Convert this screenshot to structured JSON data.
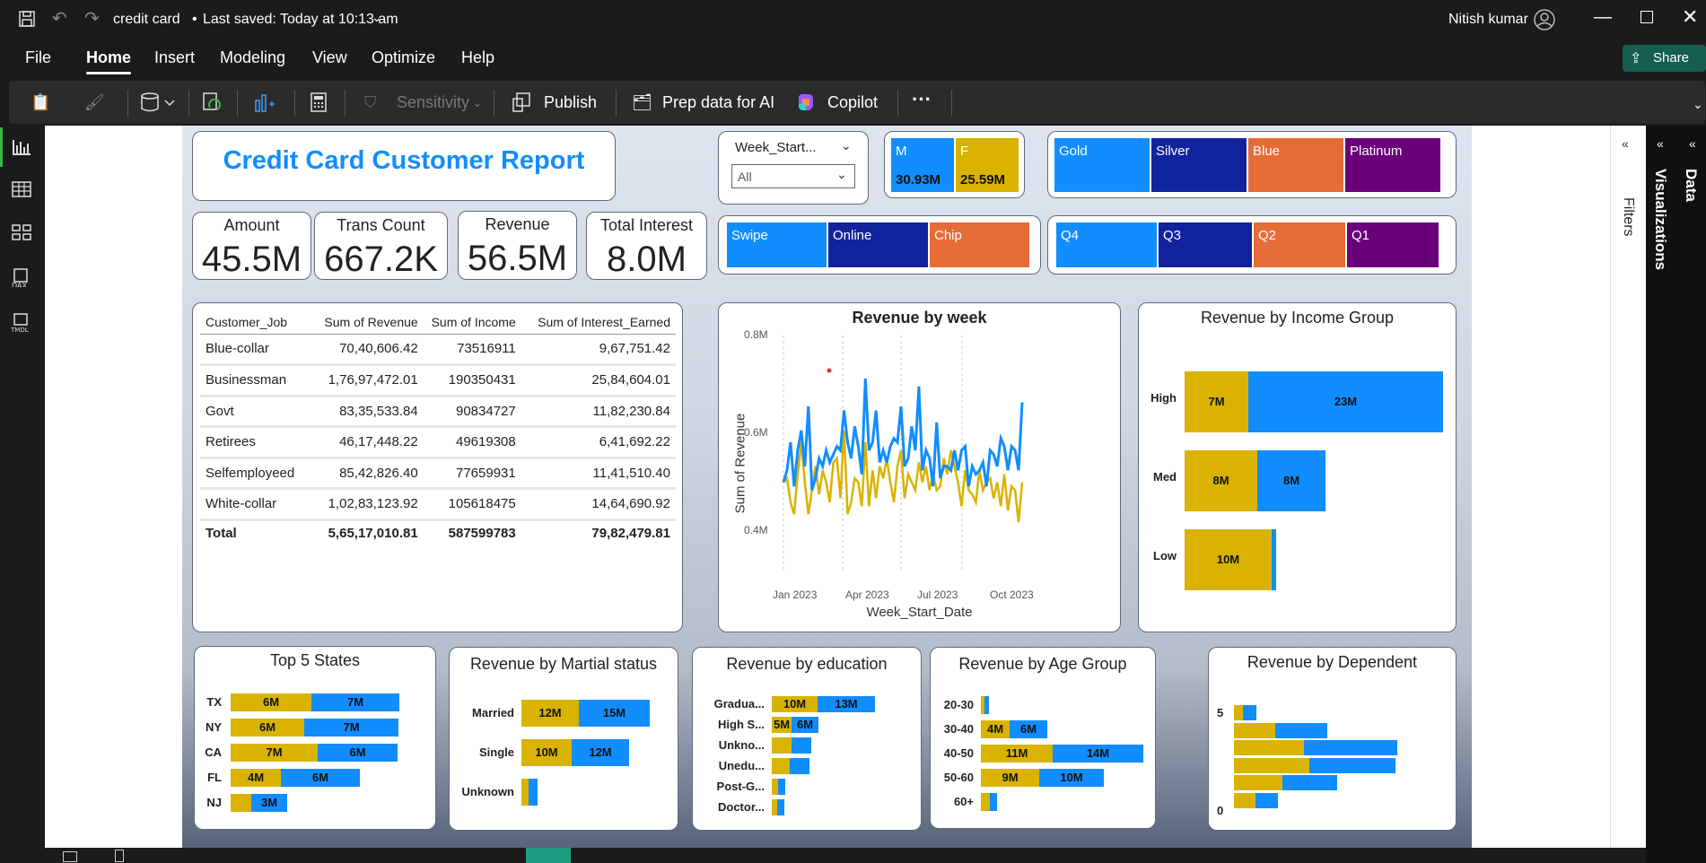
{
  "titlebar": {
    "file_name": "credit card",
    "saved_status": "Last saved: Today at 10:13 am",
    "user_name": "Nitish kumar"
  },
  "menu": [
    "File",
    "Home",
    "Insert",
    "Modeling",
    "View",
    "Optimize",
    "Help"
  ],
  "share_label": "Share",
  "ribbon": {
    "sensitivity": "Sensitivity",
    "publish": "Publish",
    "prep_data": "Prep data for AI",
    "copilot": "Copilot",
    "more": "···"
  },
  "side_panes": {
    "filters": "Filters",
    "visualizations": "Visualizations",
    "data": "Data"
  },
  "report": {
    "title": "Credit Card Customer Report",
    "kpis": [
      {
        "label": "Amount",
        "value": "45.5M"
      },
      {
        "label": "Trans Count",
        "value": "667.2K"
      },
      {
        "label": "Revenue",
        "value": "56.5M"
      },
      {
        "label": "Total Interest",
        "value": "8.0M"
      }
    ],
    "week_slicer": {
      "title": "Week_Start...",
      "value": "All"
    },
    "gender": [
      {
        "label": "M",
        "value": "30.93M",
        "color": "#118dff"
      },
      {
        "label": "F",
        "value": "25.59M",
        "color": "#d9b300"
      }
    ],
    "card_category": [
      {
        "label": "Gold",
        "color": "#118dff"
      },
      {
        "label": "Silver",
        "color": "#12239e"
      },
      {
        "label": "Blue",
        "color": "#e66c37"
      },
      {
        "label": "Platinum",
        "color": "#6b007b"
      }
    ],
    "use_chip": [
      {
        "label": "Swipe",
        "color": "#118dff"
      },
      {
        "label": "Online",
        "color": "#12239e"
      },
      {
        "label": "Chip",
        "color": "#e66c37"
      }
    ],
    "quarters": [
      {
        "label": "Q4",
        "color": "#118dff"
      },
      {
        "label": "Q3",
        "color": "#12239e"
      },
      {
        "label": "Q2",
        "color": "#e66c37"
      },
      {
        "label": "Q1",
        "color": "#6b007b"
      }
    ],
    "matrix": {
      "headers": [
        "Customer_Job",
        "Sum of Revenue",
        "Sum of Income",
        "Sum of Interest_Earned"
      ],
      "rows": [
        [
          "Blue-collar",
          "70,40,606.42",
          "73516911",
          "9,67,751.42"
        ],
        [
          "Businessman",
          "1,76,97,472.01",
          "190350431",
          "25,84,604.01"
        ],
        [
          "Govt",
          "83,35,533.84",
          "90834727",
          "11,82,230.84"
        ],
        [
          "Retirees",
          "46,17,448.22",
          "49619308",
          "6,41,692.22"
        ],
        [
          "Selfemployeed",
          "85,42,826.40",
          "77659931",
          "11,41,510.40"
        ],
        [
          "White-collar",
          "1,02,83,123.92",
          "105618475",
          "14,64,690.92"
        ]
      ],
      "total": [
        "Total",
        "5,65,17,010.81",
        "587599783",
        "79,82,479.81"
      ]
    },
    "revenue_by_week": {
      "title": "Revenue by week",
      "xlabel": "Week_Start_Date",
      "ylabel": "Sum of Revenue",
      "yticks": [
        "0.8M",
        "0.6M",
        "0.4M"
      ],
      "xticks": [
        "Jan 2023",
        "Apr 2023",
        "Jul 2023",
        "Oct 2023"
      ]
    },
    "income_group": {
      "title": "Revenue by Income Group",
      "rows": [
        {
          "label": "High",
          "f": "7M",
          "m": "23M"
        },
        {
          "label": "Med",
          "f": "8M",
          "m": "8M"
        },
        {
          "label": "Low",
          "f": "10M",
          "m": ""
        }
      ]
    },
    "top_states": {
      "title": "Top 5 States",
      "rows": [
        {
          "label": "TX",
          "f": "6M",
          "m": "7M"
        },
        {
          "label": "NY",
          "f": "6M",
          "m": "7M"
        },
        {
          "label": "CA",
          "f": "7M",
          "m": "6M"
        },
        {
          "label": "FL",
          "f": "4M",
          "m": "6M"
        },
        {
          "label": "NJ",
          "f": "",
          "m": "3M"
        }
      ]
    },
    "marital": {
      "title": "Revenue by Martial status",
      "rows": [
        {
          "label": "Married",
          "f": "12M",
          "m": "15M"
        },
        {
          "label": "Single",
          "f": "10M",
          "m": "12M"
        },
        {
          "label": "Unknown",
          "f": "",
          "m": ""
        }
      ]
    },
    "education": {
      "title": "Revenue by education",
      "rows": [
        {
          "label": "Gradua...",
          "f": "10M",
          "m": "13M"
        },
        {
          "label": "High S...",
          "f": "5M",
          "m": "6M"
        },
        {
          "label": "Unkno...",
          "f": "",
          "m": ""
        },
        {
          "label": "Unedu...",
          "f": "",
          "m": ""
        },
        {
          "label": "Post-G...",
          "f": "",
          "m": ""
        },
        {
          "label": "Doctor...",
          "f": "",
          "m": ""
        }
      ]
    },
    "age_group": {
      "title": "Revenue by Age Group",
      "rows": [
        {
          "label": "20-30",
          "f": "",
          "m": ""
        },
        {
          "label": "30-40",
          "f": "4M",
          "m": "6M"
        },
        {
          "label": "40-50",
          "f": "11M",
          "m": "14M"
        },
        {
          "label": "50-60",
          "f": "9M",
          "m": "10M"
        },
        {
          "label": "60+",
          "f": "",
          "m": ""
        }
      ]
    },
    "dependent": {
      "title": "Revenue by Dependent",
      "labels": [
        "5",
        "0"
      ]
    }
  },
  "colors": {
    "female": "#d9b300",
    "male": "#118dff",
    "accent": "#118dff"
  }
}
